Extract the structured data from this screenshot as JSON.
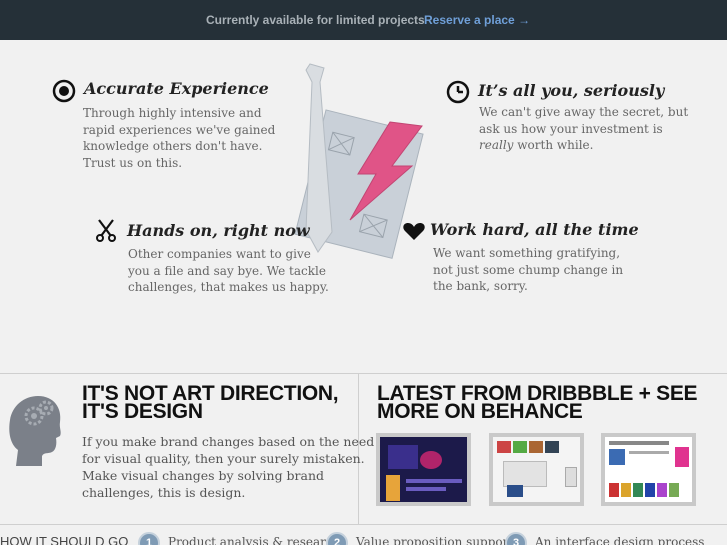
{
  "topbar": {
    "message": "Currently available for limited projects",
    "cta": "Reserve a place →"
  },
  "features": [
    {
      "icon": "target-icon",
      "title": "Accurate Experience",
      "lines": [
        "Through highly intensive and",
        "rapid experiences we've gained",
        "knowledge others don't have.",
        "Trust us on this."
      ]
    },
    {
      "icon": "clock-icon",
      "title": "It’s all you, seriously",
      "lines": [
        "We can't give away the secret, but",
        "ask us how your investment is",
        "really worth while."
      ]
    },
    {
      "icon": "scissors-icon",
      "title": "Hands on, right now",
      "lines": [
        "Other companies want to give",
        "you a file and say bye. We tackle",
        "challenges, that makes us happy."
      ]
    },
    {
      "icon": "heart-icon",
      "title": "Work hard, all the time",
      "lines": [
        "We want something gratifying,",
        "not just some chump change in",
        "the bank, sorry."
      ]
    }
  ],
  "section_art": {
    "title_lines": [
      "IT'S NOT ART DIRECTION,",
      "IT'S DESIGN"
    ],
    "text_lines": [
      "If you make brand changes based on the need",
      "for visual quality, then your surely mistaken.",
      "Make visual changes by solving brand",
      "challenges, this is design."
    ]
  },
  "section_dribbble": {
    "title_lines": [
      "LATEST FROM DRIBBBLE + SEE",
      "MORE ON BEHANCE"
    ],
    "shots": [
      "dribbble-shot-1",
      "dribbble-shot-2",
      "dribbble-shot-3"
    ]
  },
  "howto": {
    "label": "HOW IT SHOULD GO",
    "steps": [
      {
        "num": "1",
        "label": "Product analysis & research"
      },
      {
        "num": "2",
        "label": "Value proposition support"
      },
      {
        "num": "3",
        "label": "An interface design process"
      }
    ]
  },
  "colors": {
    "topbar_bg": "#253038",
    "cta": "#6f9fd8",
    "accent_pink": "#e05487",
    "step_circle": "#7f9bb5"
  }
}
